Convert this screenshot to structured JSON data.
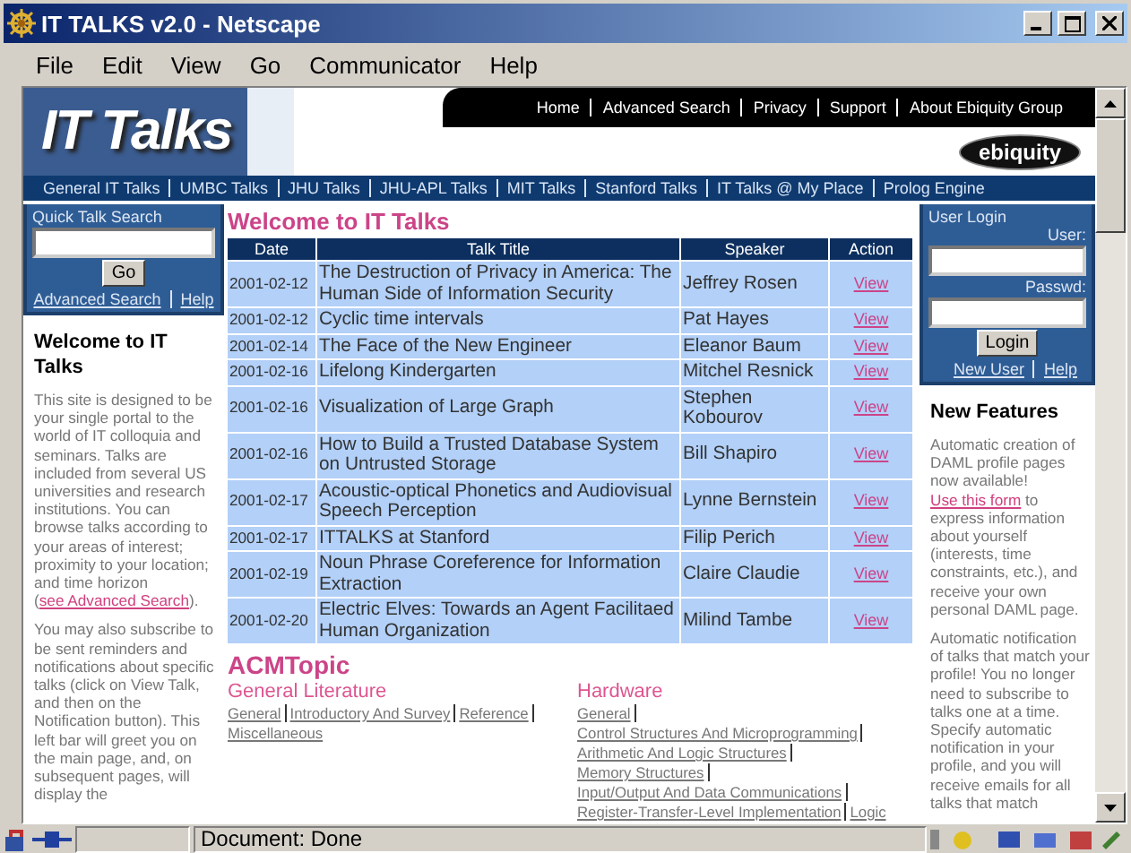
{
  "window": {
    "title": "IT TALKS v2.0 - Netscape"
  },
  "menu": [
    "File",
    "Edit",
    "View",
    "Go",
    "Communicator",
    "Help"
  ],
  "header": {
    "logo": "IT Talks",
    "links": [
      "Home",
      "Advanced Search",
      "Privacy",
      "Support",
      "About Ebiquity Group"
    ],
    "badge": "ebiquity"
  },
  "nav": [
    "General IT Talks",
    "UMBC Talks",
    "JHU Talks",
    "JHU-APL Talks",
    "MIT Talks",
    "Stanford Talks",
    "IT Talks @ My Place",
    "Prolog Engine"
  ],
  "search": {
    "title": "Quick Talk Search",
    "button": "Go",
    "links": [
      "Advanced Search",
      "Help"
    ]
  },
  "left": {
    "heading": "Welcome to IT Talks",
    "paragraphs": [
      {
        "before": "This site is designed to be your single portal to the world of IT colloquia and seminars. Talks are included from several US universities and research institutions. You can browse talks according to your areas of interest; proximity to your location; and time horizon (",
        "link": "see Advanced Search",
        "after": ")."
      },
      {
        "before": "You may also subscribe to be sent reminders and notifications about specific talks (click on View Talk, and then on the Notification button). This left bar will greet you on the main page, and, on subsequent pages, will display the"
      }
    ]
  },
  "main": {
    "heading": "Welcome to IT Talks",
    "columns": [
      "Date",
      "Talk Title",
      "Speaker",
      "Action"
    ],
    "rows": [
      [
        "2001-02-12",
        "The Destruction of Privacy in America: The Human Side of Information Security",
        "Jeffrey Rosen",
        "View"
      ],
      [
        "2001-02-12",
        "Cyclic time intervals",
        "Pat Hayes",
        "View"
      ],
      [
        "2001-02-14",
        "The Face of the New Engineer",
        "Eleanor Baum",
        "View"
      ],
      [
        "2001-02-16",
        "Lifelong Kindergarten",
        "Mitchel Resnick",
        "View"
      ],
      [
        "2001-02-16",
        "Visualization of Large Graph",
        "Stephen Kobourov",
        "View"
      ],
      [
        "2001-02-16",
        "How to Build a Trusted Database System on Untrusted Storage",
        "Bill Shapiro",
        "View"
      ],
      [
        "2001-02-17",
        "Acoustic-optical Phonetics and Audiovisual Speech Perception",
        "Lynne Bernstein",
        "View"
      ],
      [
        "2001-02-17",
        "ITTALKS at Stanford",
        "Filip Perich",
        "View"
      ],
      [
        "2001-02-19",
        "Noun Phrase Coreference for Information Extraction",
        "Claire Claudie",
        "View"
      ],
      [
        "2001-02-20",
        "Electric Elves: Towards an Agent Facilitaed Human Organization",
        "Milind Tambe",
        "View"
      ]
    ],
    "topics_heading": "ACMTopic",
    "topics": [
      {
        "title": "General Literature",
        "items": [
          "General",
          "Introductory And Survey",
          "Reference",
          "Miscellaneous"
        ]
      },
      {
        "title": "Hardware",
        "items": [
          "General",
          "Control Structures And Microprogramming",
          "Arithmetic And Logic Structures",
          "Memory Structures",
          "Input/Output And Data Communications",
          "Register-Transfer-Level Implementation",
          "Logic"
        ]
      }
    ]
  },
  "login": {
    "title": "User Login",
    "user_label": "User:",
    "password_label": "Passwd:",
    "button": "Login",
    "links": [
      "New User",
      "Help"
    ]
  },
  "right": {
    "heading": "New Features",
    "paragraphs": [
      {
        "before": "Automatic creation of DAML profile pages now available! ",
        "link": "Use this form",
        "after": " to express information about yourself (interests, time constraints, etc.), and receive your own personal DAML page."
      },
      {
        "before": "Automatic notification of talks that match your profile! You no longer need to subscribe to talks one at a time. Specify automatic notification in your profile, and you will receive emails for all talks that match"
      }
    ]
  },
  "status_bar": {
    "text": "Document: Done"
  }
}
